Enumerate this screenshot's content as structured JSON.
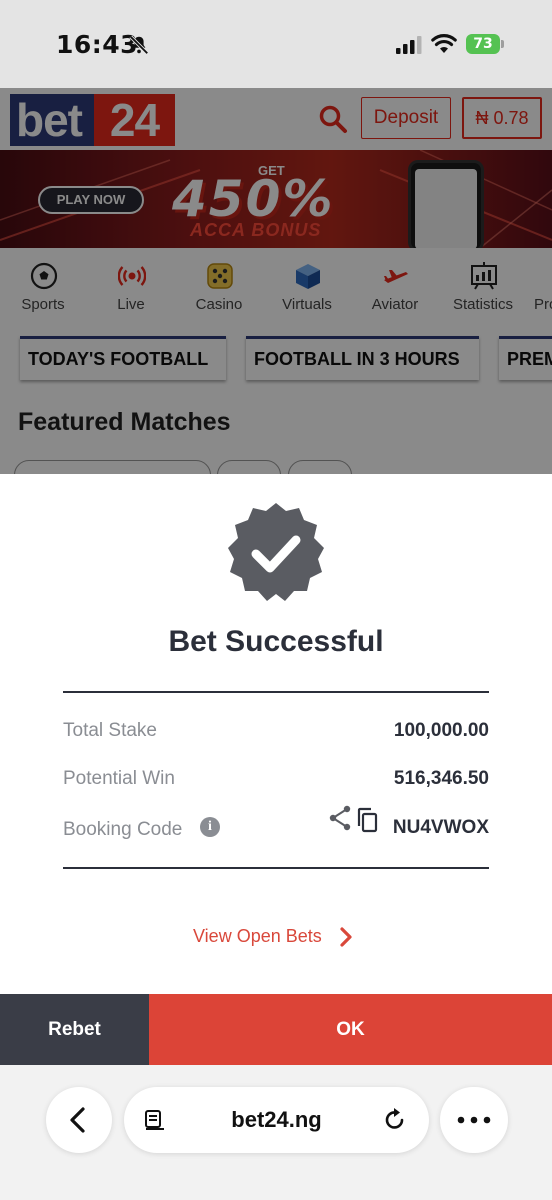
{
  "status_bar": {
    "time": "16:43",
    "battery_level": "73",
    "icons": [
      "bell-slash-icon",
      "cellular-signal-icon",
      "wifi-icon",
      "battery-icon"
    ]
  },
  "site": {
    "logo_part1": "bet",
    "logo_part2": "24",
    "deposit_label": "Deposit",
    "balance": "₦ 0.78",
    "brand_colors": {
      "navy": "#2d3a78",
      "red": "#e8291c"
    }
  },
  "banner": {
    "play_now": "PLAY NOW",
    "get": "GET",
    "percent": "450%",
    "acca": "ACCA BONUS"
  },
  "categories": [
    {
      "label": "Sports",
      "icon": "soccer-ball-icon"
    },
    {
      "label": "Live",
      "icon": "live-broadcast-icon"
    },
    {
      "label": "Casino",
      "icon": "dice-icon"
    },
    {
      "label": "Virtuals",
      "icon": "cube-icon"
    },
    {
      "label": "Aviator",
      "icon": "plane-icon"
    },
    {
      "label": "Statistics",
      "icon": "chart-board-icon"
    },
    {
      "label": "Pro",
      "icon": "promo-icon"
    }
  ],
  "tabs": [
    {
      "label": "TODAY'S FOOTBALL"
    },
    {
      "label": "FOOTBALL IN 3 HOURS"
    },
    {
      "label": "PREM"
    }
  ],
  "featured_title": "Featured Matches",
  "modal": {
    "title": "Bet Successful",
    "total_stake_label": "Total Stake",
    "total_stake_value": "100,000.00",
    "potential_win_label": "Potential Win",
    "potential_win_value": "516,346.50",
    "booking_code_label": "Booking Code",
    "booking_code_value": "NU4VWOX",
    "view_open_bets": "View Open Bets",
    "rebet_label": "Rebet",
    "ok_label": "OK",
    "accent_color": "#dc4437"
  },
  "browser": {
    "url": "bet24.ng"
  }
}
